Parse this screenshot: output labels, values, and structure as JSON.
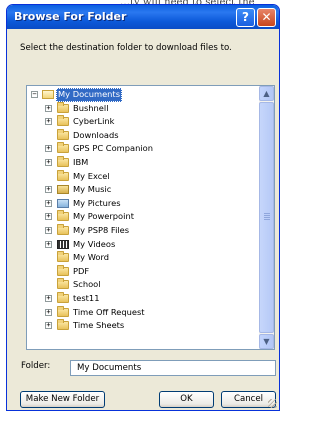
{
  "background_text": "…ty will need to select the",
  "dialog": {
    "title": "Browse For Folder",
    "help_label": "?",
    "close_label": "✕",
    "instruction": "Select the destination folder to download files to."
  },
  "tree": {
    "root": {
      "label": "My Documents",
      "expander": "⊟",
      "icon": "my-documents-icon",
      "selected": true
    },
    "items": [
      {
        "label": "Bushnell",
        "expander": "+",
        "icon": "folder-icon"
      },
      {
        "label": "CyberLink",
        "expander": "+",
        "icon": "folder-icon"
      },
      {
        "label": "Downloads",
        "expander": "",
        "icon": "folder-icon"
      },
      {
        "label": "GPS PC Companion",
        "expander": "+",
        "icon": "folder-icon"
      },
      {
        "label": "IBM",
        "expander": "+",
        "icon": "folder-icon"
      },
      {
        "label": "My Excel",
        "expander": "",
        "icon": "folder-icon"
      },
      {
        "label": "My Music",
        "expander": "+",
        "icon": "music-folder-icon"
      },
      {
        "label": "My Pictures",
        "expander": "+",
        "icon": "pictures-folder-icon"
      },
      {
        "label": "My Powerpoint",
        "expander": "+",
        "icon": "folder-icon"
      },
      {
        "label": "My PSP8 Files",
        "expander": "+",
        "icon": "folder-icon"
      },
      {
        "label": "My Videos",
        "expander": "+",
        "icon": "videos-folder-icon"
      },
      {
        "label": "My Word",
        "expander": "",
        "icon": "folder-icon"
      },
      {
        "label": "PDF",
        "expander": "",
        "icon": "folder-icon"
      },
      {
        "label": "School",
        "expander": "",
        "icon": "folder-icon"
      },
      {
        "label": "test11",
        "expander": "+",
        "icon": "folder-icon"
      },
      {
        "label": "Time Off Request",
        "expander": "+",
        "icon": "folder-icon"
      },
      {
        "label": "Time Sheets",
        "expander": "+",
        "icon": "folder-icon"
      }
    ]
  },
  "folder_field": {
    "label": "Folder:",
    "value": "My Documents"
  },
  "buttons": {
    "make_new_folder": "Make New Folder",
    "ok": "OK",
    "cancel": "Cancel"
  },
  "scrollbar": {
    "up": "▲",
    "down": "▼"
  },
  "colors": {
    "titlebar": "#0a5fe0",
    "selection": "#316ac5",
    "dialog_bg": "#ece9d8"
  }
}
